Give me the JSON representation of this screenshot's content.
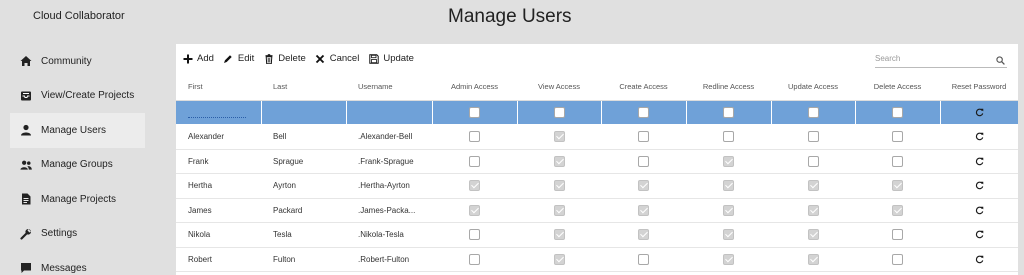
{
  "app": {
    "title": "Cloud Collaborator"
  },
  "page": {
    "title": "Manage Users"
  },
  "sidebar": {
    "items": [
      {
        "label": "Community",
        "icon": "home-icon"
      },
      {
        "label": "View/Create Projects",
        "icon": "inbox-icon"
      },
      {
        "label": "Manage Users",
        "icon": "user-icon",
        "active": true
      },
      {
        "label": "Manage Groups",
        "icon": "users-icon"
      },
      {
        "label": "Manage Projects",
        "icon": "document-icon"
      },
      {
        "label": "Settings",
        "icon": "wrench-icon"
      },
      {
        "label": "Messages",
        "icon": "message-icon"
      }
    ]
  },
  "toolbar": {
    "add": "Add",
    "edit": "Edit",
    "delete": "Delete",
    "cancel": "Cancel",
    "update": "Update",
    "search_placeholder": "Search"
  },
  "table": {
    "headers": [
      "First",
      "Last",
      "Username",
      "Admin Access",
      "View Access",
      "Create Access",
      "Redline Access",
      "Update Access",
      "Delete Access",
      "Reset Password"
    ],
    "rows": [
      {
        "first": "Alexander",
        "last": "Bell",
        "username": ".Alexander-Bell",
        "access": [
          false,
          true,
          false,
          false,
          false,
          false
        ]
      },
      {
        "first": "Frank",
        "last": "Sprague",
        "username": ".Frank-Sprague",
        "access": [
          false,
          true,
          false,
          true,
          false,
          false
        ]
      },
      {
        "first": "Hertha",
        "last": "Ayrton",
        "username": ".Hertha-Ayrton",
        "access": [
          true,
          true,
          true,
          true,
          true,
          true
        ]
      },
      {
        "first": "James",
        "last": "Packard",
        "username": ".James-Packa...",
        "access": [
          true,
          true,
          true,
          true,
          true,
          true
        ]
      },
      {
        "first": "Nikola",
        "last": "Tesla",
        "username": ".Nikola-Tesla",
        "access": [
          false,
          true,
          true,
          true,
          true,
          false
        ]
      },
      {
        "first": "Robert",
        "last": "Fulton",
        "username": ".Robert-Fulton",
        "access": [
          false,
          true,
          false,
          true,
          true,
          false
        ]
      }
    ]
  },
  "colors": {
    "filter_row": "#6fa1d8",
    "background": "#e0e0e0",
    "checked": "#d3d3d3"
  }
}
